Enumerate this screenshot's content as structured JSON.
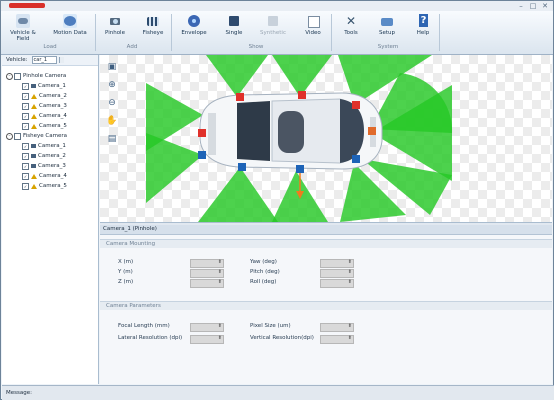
{
  "window": {
    "minimize": "–",
    "maximize": "□",
    "close": "✕"
  },
  "ribbon": {
    "buttons": [
      {
        "label": "Vehicle & Field",
        "icon": "vehicle-icon"
      },
      {
        "label": "Motion Data",
        "icon": "motion-data-icon"
      },
      {
        "label": "Pinhole",
        "icon": "pinhole-camera-icon"
      },
      {
        "label": "Fisheye",
        "icon": "fisheye-camera-icon"
      },
      {
        "label": "Envelope",
        "icon": "envelope-icon"
      },
      {
        "label": "Single",
        "icon": "single-view-icon"
      },
      {
        "label": "Synthetic",
        "icon": "synthetic-view-icon"
      },
      {
        "label": "Video",
        "icon": "video-icon"
      },
      {
        "label": "Tools",
        "icon": "tools-icon"
      },
      {
        "label": "Setup",
        "icon": "setup-icon"
      },
      {
        "label": "Help",
        "icon": "help-icon"
      }
    ],
    "groups": [
      "Load",
      "Add",
      "Show",
      "System"
    ]
  },
  "left_panel": {
    "vehicle_label": "Vehicle:",
    "vehicle_value": "car_1",
    "tree": {
      "pinhole": {
        "label": "Pinhole Camera",
        "cameras": [
          "Camera_1",
          "Camera_2",
          "Camera_3",
          "Camera_4",
          "Camera_5"
        ]
      },
      "fisheye": {
        "label": "Fisheye Camera",
        "cameras": [
          "Camera_1",
          "Camera_2",
          "Camera_3",
          "Camera_4",
          "Camera_5"
        ]
      }
    }
  },
  "properties": {
    "title": "Camera_1 (Pinhole)",
    "mounting": {
      "section": "Camera Mounting",
      "x": "X (m)",
      "y": "Y (m)",
      "z": "Z (m)",
      "yaw": "Yaw (deg)",
      "pitch": "Pitch (deg)",
      "roll": "Roll (deg)"
    },
    "parameters": {
      "section": "Camera Parameters",
      "focal": "Focal Length (mm)",
      "lateral": "Lateral Resolution (dpi)",
      "pixel": "Pixel Size (um)",
      "vertical": "Vertical Resolution(dpi)"
    }
  },
  "status": {
    "message_label": "Message:"
  },
  "colors": {
    "fov": "#26c826",
    "car_body": "#f5f7f9",
    "marker_red": "#e0312b",
    "marker_blue": "#1d63b7"
  }
}
